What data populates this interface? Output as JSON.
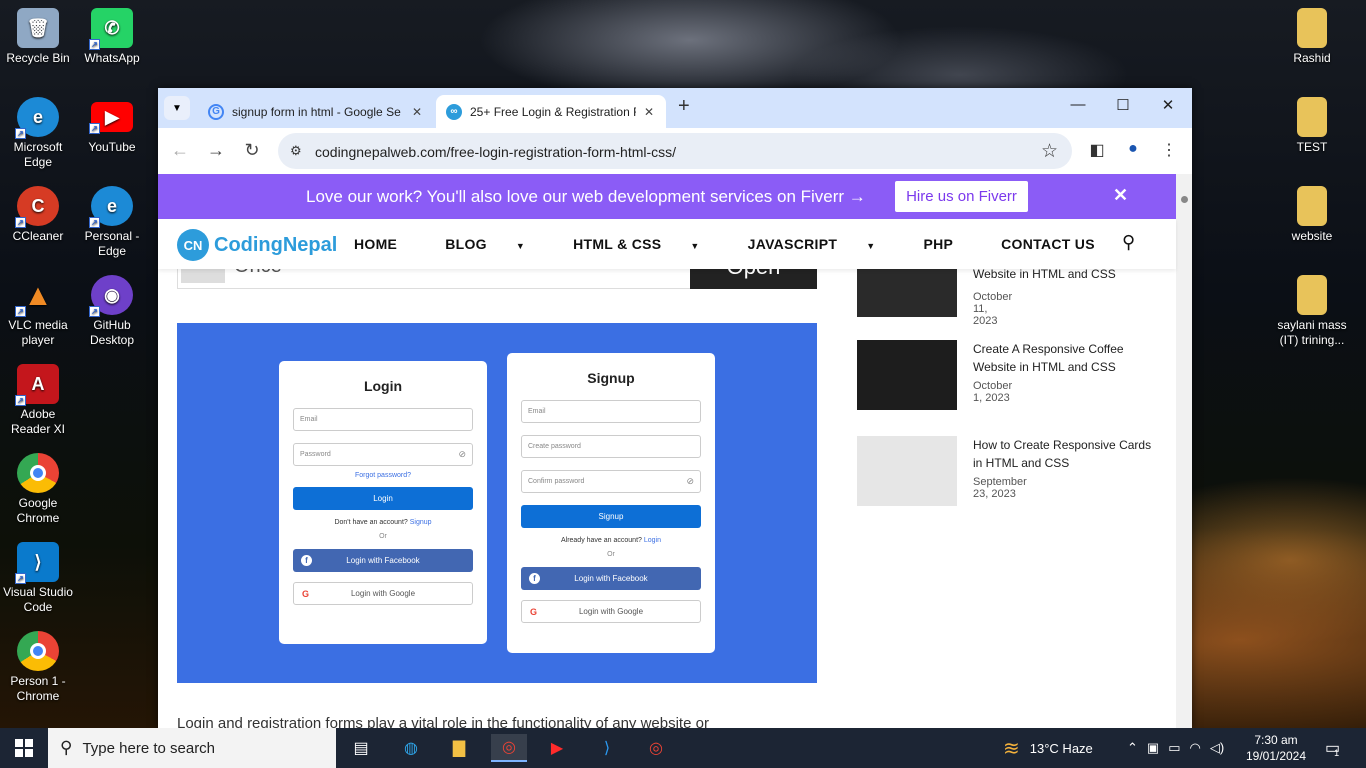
{
  "desktop": {
    "left_icons": [
      {
        "label": "Recycle Bin",
        "icon": "recycle-bin-icon",
        "glyph": "🗑",
        "color": "#8fa8c4"
      },
      {
        "label": "WhatsApp",
        "icon": "whatsapp-icon",
        "glyph": "✆",
        "color": "#25d366"
      },
      {
        "label": "Microsoft Edge",
        "icon": "edge-icon",
        "glyph": "e",
        "color": "#1c8ad6"
      },
      {
        "label": "YouTube",
        "icon": "youtube-icon",
        "glyph": "▶",
        "color": "#ff0000"
      },
      {
        "label": "CCleaner",
        "icon": "ccleaner-icon",
        "glyph": "C",
        "color": "#d63b24"
      },
      {
        "label": "Personal - Edge",
        "icon": "edge-profile-icon",
        "glyph": "e",
        "color": "#1c8ad6"
      },
      {
        "label": "VLC media player",
        "icon": "vlc-icon",
        "glyph": "▲",
        "color": "#f08a24"
      },
      {
        "label": "GitHub Desktop",
        "icon": "github-desktop-icon",
        "glyph": "◉",
        "color": "#6e40c9"
      },
      {
        "label": "Adobe Reader XI",
        "icon": "adobe-reader-icon",
        "glyph": "A",
        "color": "#c4161c"
      },
      {
        "label": "Google Chrome",
        "icon": "chrome-icon",
        "glyph": "◎",
        "color": "#34a853"
      },
      {
        "label": "Visual Studio Code",
        "icon": "vscode-icon",
        "glyph": "⟩",
        "color": "#0a7acc"
      },
      {
        "label": "Person 1 - Chrome",
        "icon": "chrome-profile-icon",
        "glyph": "◎",
        "color": "#ea4335"
      }
    ],
    "right_icons": [
      {
        "label": "Rashid",
        "icon": "folder-icon"
      },
      {
        "label": "TEST",
        "icon": "folder-icon"
      },
      {
        "label": "website",
        "icon": "folder-icon"
      },
      {
        "label": "saylani mass (IT) trining...",
        "icon": "folder-icon"
      }
    ]
  },
  "browser": {
    "tabs": [
      {
        "title": "signup form in html - Google Se",
        "favicon": "google-icon",
        "close": "✕"
      },
      {
        "title": "25+ Free Login & Registration F",
        "favicon": "codingnepal-icon",
        "close": "✕"
      }
    ],
    "new_tab": "+",
    "url": "codingnepalweb.com/free-login-registration-form-html-css/"
  },
  "promo": {
    "text": "Love our work? You'll also love our web development services on Fiverr →",
    "button": "Hire us on Fiverr",
    "close": "✕"
  },
  "site": {
    "logo_text": "CodingNepal",
    "logo_mark": "CN",
    "menu": [
      {
        "label": "HOME",
        "dropdown": false
      },
      {
        "label": "BLOG",
        "dropdown": true
      },
      {
        "label": "HTML & CSS",
        "dropdown": true
      },
      {
        "label": "JAVASCRIPT",
        "dropdown": true
      },
      {
        "label": "PHP",
        "dropdown": false
      },
      {
        "label": "CONTACT US",
        "dropdown": false
      }
    ]
  },
  "ad": {
    "text": "Once",
    "button": "Open"
  },
  "hero": {
    "login": {
      "title": "Login",
      "email": "Email",
      "password": "Password",
      "forgot": "Forgot password?",
      "button": "Login",
      "note": "Don't have an account?",
      "note_link": "Signup",
      "or": "Or",
      "facebook": "Login with Facebook",
      "google": "Login with Google"
    },
    "signup": {
      "title": "Signup",
      "email": "Email",
      "create": "Create password",
      "confirm": "Confirm password",
      "button": "Signup",
      "note": "Already have an account?",
      "note_link": "Login",
      "or": "Or",
      "facebook": "Login with Facebook",
      "google": "Login with Google"
    }
  },
  "article_text": "Login and registration forms play a vital role in the functionality of any website or",
  "sidebar_posts": [
    {
      "title": "How to Create Responsive Pets Website in HTML and CSS",
      "date": "October 11, 2023"
    },
    {
      "title": "Create A Responsive Coffee Website in HTML and CSS",
      "date": "October 1, 2023"
    },
    {
      "title": "How to Create Responsive Cards in HTML and CSS",
      "date": "September 23, 2023"
    }
  ],
  "taskbar": {
    "search_placeholder": "Type here to search",
    "weather": "13°C  Haze",
    "time": "7:30 am",
    "date": "19/01/2024",
    "notification_count": "1"
  },
  "colors": {
    "promo_bg": "#8b5cf6",
    "hero_bg": "#3b6fe3",
    "tab_strip": "#d3e3fd",
    "brand": "#2d9cdb"
  }
}
